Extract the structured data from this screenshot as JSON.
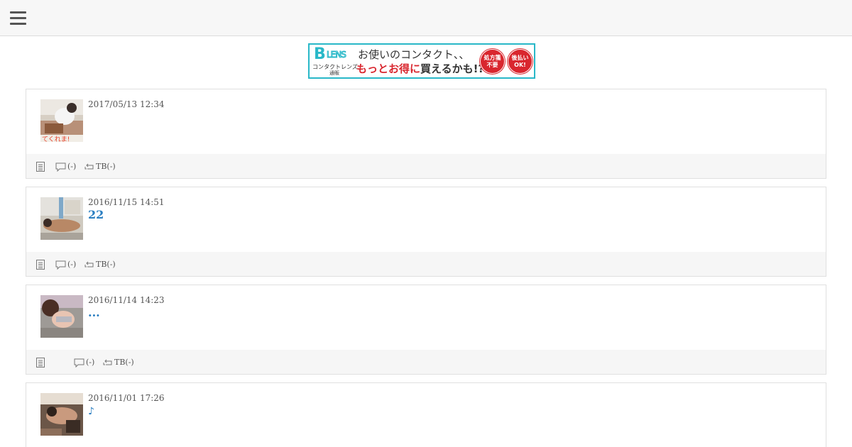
{
  "menu": {
    "icon": "hamburger-menu-icon"
  },
  "banner": {
    "logo_letter": "B",
    "logo_word": "LENS",
    "logo_sub": "コンタクトレンズ",
    "logo_sub2": "通販",
    "line1": "お使いのコンタクト、、",
    "line2_red": "もっとお得に",
    "line2_dark": "買えるかも!?",
    "badge1_line1": "処方箋",
    "badge1_line2": "不要",
    "badge2_line1": "後払い",
    "badge2_line2": "OK!",
    "accent_color": "#29b8c8",
    "badge_color": "#d9262e"
  },
  "entries": [
    {
      "date": "2017/05/13 12:34",
      "title": "",
      "comments": "(-)",
      "tb": "TB(-)",
      "thumb_caption": "てくれま!"
    },
    {
      "date": "2016/11/15 14:51",
      "title": "22",
      "comments": "(-)",
      "tb": "TB(-)"
    },
    {
      "date": "2016/11/14 14:23",
      "title": "...",
      "comments": "(-)",
      "tb": "TB(-)"
    },
    {
      "date": "2016/11/01 17:26",
      "title": "♪"
    }
  ],
  "colors": {
    "link": "#2a7ec1",
    "text": "#555555",
    "footer_bg": "#f6f6f6"
  }
}
